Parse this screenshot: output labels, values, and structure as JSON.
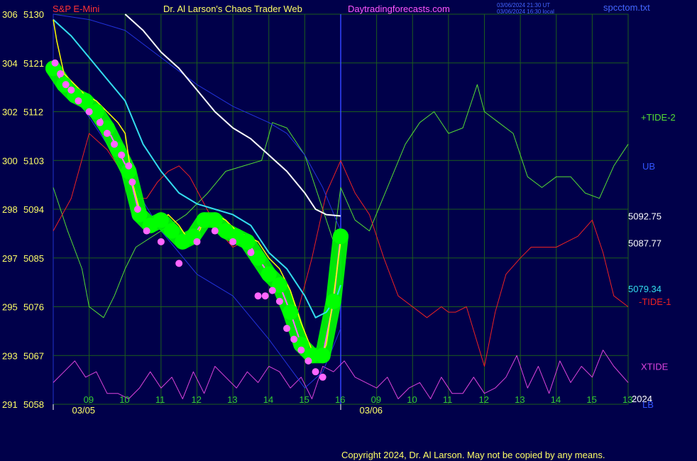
{
  "header": {
    "symbol": "S&P E-Mini",
    "author": "Dr. Al Larson's Chaos Trader Web",
    "site": "Daytradingforecasts.com",
    "stamp_line1": "03/06/2024 21:30 UT",
    "stamp_line2": "03/06/2024 16:30 local",
    "file": "spcctom.txt"
  },
  "footer": {
    "copyright": "Copyright 2024, Dr. Al Larson. May not be copied by any means."
  },
  "colors": {
    "background": "#00004a",
    "grid": "#1c5c1c",
    "price": "#ff66ff",
    "band": "#00ff00",
    "yellow_avg": "#ffff00",
    "cyan_avg": "#33ddee",
    "white_avg": "#ffffff",
    "blue_band": "#2233dd",
    "tide2": "#55dd33",
    "tide1": "#ee2222",
    "xtide": "#dd44dd"
  },
  "chart_data": {
    "type": "line",
    "x_type": "time",
    "xlim": [
      8.0,
      24.0
    ],
    "ylim": [
      5058,
      5130
    ],
    "y_ticks": [
      {
        "left": "306",
        "right": "5130",
        "v": 5130
      },
      {
        "left": "304",
        "right": "5121",
        "v": 5121
      },
      {
        "left": "302",
        "right": "5112",
        "v": 5112
      },
      {
        "left": "300",
        "right": "5103",
        "v": 5103
      },
      {
        "left": "298",
        "right": "5094",
        "v": 5094
      },
      {
        "left": "297",
        "right": "5085",
        "v": 5085
      },
      {
        "left": "295",
        "right": "5076",
        "v": 5076
      },
      {
        "left": "293",
        "right": "5067",
        "v": 5067
      },
      {
        "left": "291",
        "right": "5058",
        "v": 5058
      }
    ],
    "x_ticks": [
      {
        "label": "09",
        "x": 9
      },
      {
        "label": "10",
        "x": 10
      },
      {
        "label": "11",
        "x": 11
      },
      {
        "label": "12",
        "x": 12
      },
      {
        "label": "13",
        "x": 13
      },
      {
        "label": "14",
        "x": 14
      },
      {
        "label": "15",
        "x": 15
      },
      {
        "label": "16",
        "x": 16
      },
      {
        "label": "09",
        "x": 17
      },
      {
        "label": "10",
        "x": 18
      },
      {
        "label": "11",
        "x": 19
      },
      {
        "label": "12",
        "x": 20
      },
      {
        "label": "13",
        "x": 21
      },
      {
        "label": "14",
        "x": 22
      },
      {
        "label": "15",
        "x": 23
      },
      {
        "label": "13",
        "x": 24
      }
    ],
    "date_labels": [
      {
        "label": "03/05",
        "x": 8.8
      },
      {
        "label": "03/06",
        "x": 16.8
      }
    ],
    "now_x": 16.0,
    "year_label": "2024",
    "right_labels": {
      "tide2": {
        "text": "+TIDE-2",
        "v": 5111
      },
      "ub": {
        "text": "UB",
        "v": 5102
      },
      "white_value": {
        "text": "5092.75",
        "v": 5092.75
      },
      "yellow_value": {
        "text": "5087.77",
        "v": 5087.77
      },
      "cyan_value": {
        "text": "5079.34",
        "v": 5079.34
      },
      "tide1": {
        "text": "-TIDE-1",
        "v": 5077
      },
      "xtide": {
        "text": "XTIDE",
        "v": 5065
      },
      "lb": {
        "text": "LB",
        "v": 5058
      }
    },
    "series": [
      {
        "key": "price",
        "x": [
          8.0,
          8.3,
          8.6,
          8.9,
          9.2,
          9.5,
          9.8,
          10.1,
          10.4,
          10.7,
          11.0,
          11.3,
          11.6,
          11.9,
          12.2,
          12.5,
          12.8,
          13.1,
          13.4,
          13.7,
          14.0,
          14.3,
          14.6,
          14.9,
          15.2,
          15.5,
          15.8,
          16.0
        ],
        "y": [
          5120,
          5117,
          5115,
          5114,
          5112,
          5109,
          5105,
          5101,
          5093,
          5091,
          5092,
          5090,
          5088,
          5089,
          5092,
          5092,
          5090,
          5089,
          5088,
          5085,
          5082,
          5080,
          5075,
          5069,
          5067,
          5067,
          5077,
          5089
        ]
      },
      {
        "key": "yellow",
        "x": [
          8.0,
          8.1,
          8.3,
          8.6,
          8.9,
          9.2,
          9.5,
          9.8,
          10.0,
          10.2,
          10.4,
          10.6,
          10.8,
          11.0,
          11.2,
          11.5,
          11.8,
          12.0,
          12.2,
          12.5,
          12.8,
          13.1,
          13.4,
          13.7,
          14.0,
          14.3,
          14.6,
          14.9,
          15.2,
          15.4,
          15.6,
          15.8,
          16.0
        ],
        "y": [
          5129,
          5125,
          5119,
          5117,
          5115,
          5114,
          5112,
          5110,
          5108,
          5099,
          5094,
          5091,
          5091,
          5092,
          5093,
          5091,
          5088,
          5089,
          5092,
          5093,
          5092,
          5090,
          5089,
          5088,
          5085,
          5083,
          5079,
          5073,
          5068,
          5066,
          5069,
          5078,
          5088
        ]
      },
      {
        "key": "cyan",
        "x": [
          8.0,
          8.5,
          9.0,
          9.5,
          10.0,
          10.5,
          11.0,
          11.5,
          12.0,
          12.5,
          13.0,
          13.5,
          14.0,
          14.5,
          15.0,
          15.3,
          15.6,
          15.9,
          16.0
        ],
        "y": [
          5129,
          5126,
          5122,
          5118,
          5114,
          5106,
          5101,
          5097,
          5095,
          5094,
          5093,
          5091,
          5086,
          5083,
          5078,
          5074,
          5075,
          5078,
          5080
        ]
      },
      {
        "key": "white",
        "x": [
          10.0,
          10.5,
          11.0,
          11.5,
          12.0,
          12.5,
          13.0,
          13.5,
          14.0,
          14.5,
          15.0,
          15.3,
          15.6,
          16.0
        ],
        "y": [
          5130,
          5127,
          5123,
          5120,
          5116,
          5112,
          5109,
          5107,
          5104,
          5101,
          5097,
          5094,
          5093,
          5092.75
        ]
      },
      {
        "key": "blue_ub",
        "x": [
          8.0,
          9.0,
          10.0,
          11.0,
          12.0,
          13.0,
          14.0,
          14.5,
          15.0,
          15.5,
          16.0
        ],
        "y": [
          5130,
          5129,
          5127,
          5122,
          5117,
          5113,
          5110,
          5108,
          5104,
          5098,
          5090
        ]
      },
      {
        "key": "blue_lb",
        "x": [
          8.0,
          9.0,
          10.0,
          11.0,
          12.0,
          13.0,
          14.0,
          15.0,
          15.5,
          16.0
        ],
        "y": [
          5120,
          5111,
          5101,
          5090,
          5082,
          5078,
          5070,
          5061,
          5064,
          5072
        ]
      },
      {
        "key": "tide2",
        "x": [
          8.0,
          8.4,
          8.8,
          9.0,
          9.4,
          9.7,
          10.0,
          10.3,
          11.0,
          11.7,
          12.3,
          12.8,
          13.3,
          13.8,
          14.1,
          14.5,
          15.0,
          15.4,
          15.8,
          16.0,
          16.4,
          16.8,
          17.3,
          17.8,
          18.2,
          18.6,
          19.0,
          19.4,
          19.8,
          20.0,
          20.4,
          20.8,
          21.2,
          21.6,
          22.0,
          22.4,
          22.8,
          23.2,
          23.6,
          24.0
        ],
        "y": [
          5098,
          5090,
          5083,
          5076,
          5074,
          5078,
          5083,
          5087,
          5090,
          5093,
          5097,
          5101,
          5102,
          5103,
          5110,
          5109,
          5104,
          5096,
          5088,
          5098,
          5092,
          5090,
          5098,
          5106,
          5110,
          5112,
          5108,
          5109,
          5117,
          5112,
          5110,
          5108,
          5100,
          5098,
          5100,
          5100,
          5097,
          5096,
          5102,
          5106
        ]
      },
      {
        "key": "tide1",
        "x": [
          8.0,
          8.5,
          9.0,
          9.5,
          10.0,
          10.3,
          10.6,
          10.9,
          11.2,
          11.5,
          11.8,
          12.2,
          12.6,
          13.0,
          13.3,
          13.7,
          14.0,
          14.4,
          14.8,
          15.2,
          15.6,
          16.0,
          16.4,
          16.8,
          17.2,
          17.6,
          18.0,
          18.4,
          18.8,
          19.0,
          19.2,
          19.5,
          20.0,
          20.3,
          20.6,
          21.0,
          21.3,
          21.6,
          22.0,
          22.3,
          22.6,
          23.0,
          23.3,
          23.6,
          24.0
        ],
        "y": [
          5090,
          5096,
          5108,
          5105,
          5100,
          5096,
          5096,
          5099,
          5101,
          5102,
          5100,
          5095,
          5090,
          5087,
          5088,
          5086,
          5083,
          5078,
          5075,
          5085,
          5097,
          5103,
          5097,
          5093,
          5085,
          5078,
          5076,
          5074,
          5076,
          5075,
          5075,
          5076,
          5065,
          5075,
          5082,
          5085,
          5087,
          5087,
          5087,
          5088,
          5089,
          5092,
          5086,
          5078,
          5076
        ]
      },
      {
        "key": "xtide",
        "x": [
          8.0,
          8.3,
          8.6,
          8.9,
          9.2,
          9.5,
          9.8,
          10.1,
          10.4,
          10.7,
          11.0,
          11.3,
          11.6,
          11.9,
          12.2,
          12.5,
          12.8,
          13.1,
          13.4,
          13.7,
          14.0,
          14.3,
          14.6,
          14.9,
          15.2,
          15.5,
          15.8,
          16.1,
          16.4,
          16.7,
          17.0,
          17.3,
          17.6,
          17.9,
          18.2,
          18.5,
          18.8,
          19.1,
          19.4,
          19.7,
          20.0,
          20.3,
          20.6,
          20.9,
          21.2,
          21.5,
          21.8,
          22.1,
          22.4,
          22.7,
          23.0,
          23.3,
          23.6,
          24.0
        ],
        "y": [
          5062,
          5064,
          5066,
          5063,
          5064,
          5060,
          5060,
          5059,
          5061,
          5064,
          5061,
          5063,
          5059,
          5064,
          5060,
          5065,
          5063,
          5061,
          5064,
          5062,
          5065,
          5064,
          5061,
          5063,
          5059,
          5065,
          5064,
          5066,
          5063,
          5062,
          5061,
          5063,
          5059,
          5061,
          5062,
          5059,
          5063,
          5060,
          5060,
          5063,
          5060,
          5061,
          5063,
          5067,
          5061,
          5065,
          5060,
          5066,
          5062,
          5065,
          5063,
          5068,
          5065,
          5062
        ]
      },
      {
        "key": "dots",
        "x": [
          8.05,
          8.2,
          8.35,
          8.5,
          8.7,
          9.0,
          9.3,
          9.5,
          9.7,
          9.9,
          10.1,
          10.2,
          10.35,
          10.6,
          11.0,
          11.5,
          12.0,
          12.5,
          13.0,
          13.5,
          13.7,
          13.9,
          14.1,
          14.3,
          14.5,
          14.7,
          14.9,
          15.1,
          15.3,
          15.5
        ],
        "y": [
          5121,
          5119,
          5117,
          5116,
          5114,
          5112,
          5110,
          5108,
          5106,
          5104,
          5102,
          5099,
          5094,
          5090,
          5088,
          5084,
          5088,
          5090,
          5088,
          5086,
          5078,
          5078,
          5079,
          5077,
          5072,
          5070,
          5068,
          5066,
          5064,
          5063
        ]
      }
    ]
  }
}
